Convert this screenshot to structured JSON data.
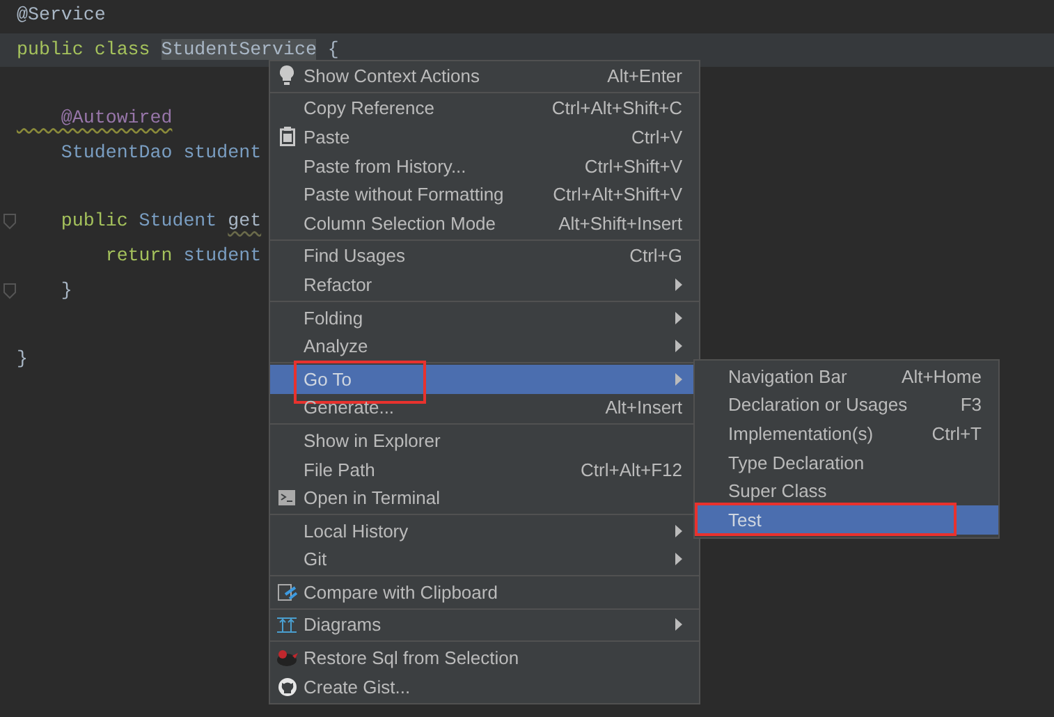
{
  "editor": {
    "lines": [
      {
        "current": false,
        "fold": false,
        "tokens": [
          {
            "kind": "plain",
            "text": "@Service"
          }
        ]
      },
      {
        "current": true,
        "fold": false,
        "tokens": [
          {
            "kind": "keyword",
            "text": "public class "
          },
          {
            "kind": "selected",
            "text": "StudentService"
          },
          {
            "kind": "plain",
            "text": " {"
          }
        ]
      },
      {
        "current": false,
        "fold": false
      },
      {
        "current": false,
        "fold": false,
        "tokens": [
          {
            "kind": "annotation",
            "text": "    @Autowired"
          }
        ]
      },
      {
        "current": false,
        "fold": false,
        "tokens": [
          {
            "kind": "type",
            "text": "    StudentDao student"
          }
        ]
      },
      {
        "current": false,
        "fold": false
      },
      {
        "current": false,
        "fold": true,
        "tokens": [
          {
            "kind": "keyword",
            "text": "    public "
          },
          {
            "kind": "type",
            "text": "Student "
          },
          {
            "kind": "method",
            "text": "get"
          }
        ]
      },
      {
        "current": false,
        "fold": false,
        "tokens": [
          {
            "kind": "keyword",
            "text": "        return "
          },
          {
            "kind": "type",
            "text": "student"
          }
        ]
      },
      {
        "current": false,
        "fold": true,
        "tokens": [
          {
            "kind": "plain",
            "text": "    }"
          }
        ]
      },
      {
        "current": false,
        "fold": false
      },
      {
        "current": false,
        "fold": false,
        "tokens": [
          {
            "kind": "plain",
            "text": "}"
          }
        ]
      }
    ]
  },
  "context_menu": {
    "groups": [
      [
        {
          "label": "Show Context Actions",
          "shortcut": "Alt+Enter",
          "kind": "bulb",
          "submenu": false,
          "selected": false
        }
      ],
      [
        {
          "label": "Copy Reference",
          "shortcut": "Ctrl+Alt+Shift+C",
          "submenu": false,
          "selected": false
        },
        {
          "label": "Paste",
          "shortcut": "Ctrl+V",
          "kind": "clipboard",
          "submenu": false,
          "selected": false
        },
        {
          "label": "Paste from History...",
          "shortcut": "Ctrl+Shift+V",
          "submenu": false,
          "selected": false
        },
        {
          "label": "Paste without Formatting",
          "shortcut": "Ctrl+Alt+Shift+V",
          "submenu": false,
          "selected": false
        },
        {
          "label": "Column Selection Mode",
          "shortcut": "Alt+Shift+Insert",
          "submenu": false,
          "selected": false
        }
      ],
      [
        {
          "label": "Find Usages",
          "shortcut": "Ctrl+G",
          "submenu": false,
          "selected": false
        },
        {
          "label": "Refactor",
          "submenu": true,
          "selected": false
        }
      ],
      [
        {
          "label": "Folding",
          "submenu": true,
          "selected": false
        },
        {
          "label": "Analyze",
          "submenu": true,
          "selected": false
        }
      ],
      [
        {
          "label": "Go To",
          "submenu": true,
          "selected": true,
          "marked": true
        },
        {
          "label": "Generate...",
          "shortcut": "Alt+Insert",
          "submenu": false,
          "selected": false
        }
      ],
      [
        {
          "label": "Show in Explorer",
          "submenu": false,
          "selected": false
        },
        {
          "label": "File Path",
          "shortcut": "Ctrl+Alt+F12",
          "submenu": false,
          "selected": false
        },
        {
          "label": "Open in Terminal",
          "kind": "terminal",
          "submenu": false,
          "selected": false
        }
      ],
      [
        {
          "label": "Local History",
          "submenu": true,
          "selected": false
        },
        {
          "label": "Git",
          "submenu": true,
          "selected": false
        }
      ],
      [
        {
          "label": "Compare with Clipboard",
          "kind": "compare",
          "submenu": false,
          "selected": false
        }
      ],
      [
        {
          "label": "Diagrams",
          "kind": "diagram",
          "submenu": true,
          "selected": false
        }
      ],
      [
        {
          "label": "Restore Sql from Selection",
          "kind": "bird",
          "submenu": false,
          "selected": false
        },
        {
          "label": "Create Gist...",
          "kind": "github",
          "submenu": false,
          "selected": false
        }
      ]
    ]
  },
  "submenu": {
    "items": [
      {
        "label": "Navigation Bar",
        "shortcut": "Alt+Home",
        "selected": false
      },
      {
        "label": "Declaration or Usages",
        "shortcut": "F3",
        "selected": false
      },
      {
        "label": "Implementation(s)",
        "shortcut": "Ctrl+T",
        "selected": false
      },
      {
        "label": "Type Declaration",
        "selected": false
      },
      {
        "label": "Super Class",
        "selected": false
      },
      {
        "label": "Test",
        "selected": true,
        "marked": true
      }
    ]
  }
}
